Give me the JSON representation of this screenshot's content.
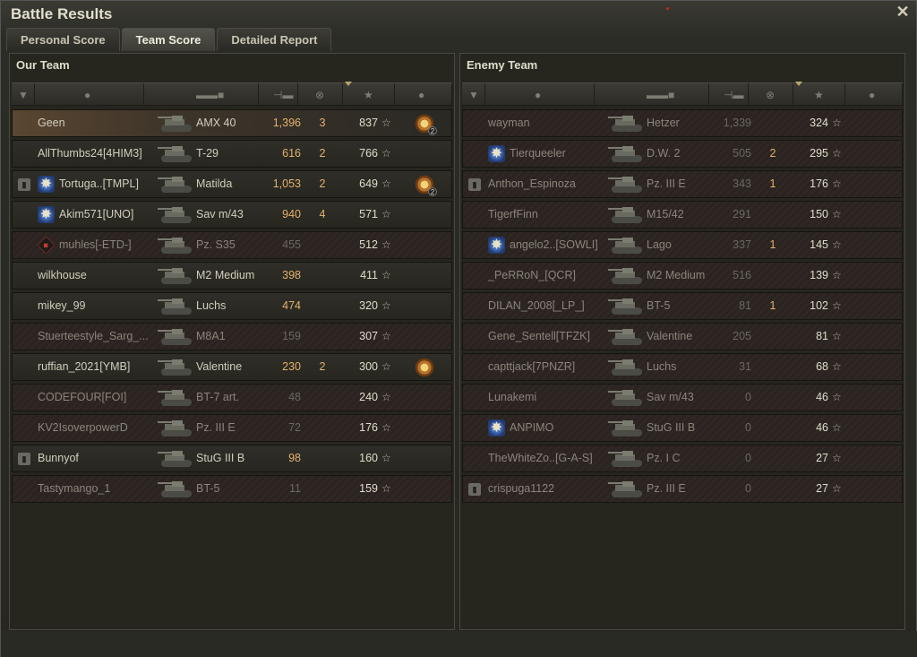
{
  "window": {
    "title": "Battle Results"
  },
  "tabs": [
    {
      "label": "Personal Score",
      "active": false
    },
    {
      "label": "Team Score",
      "active": true
    },
    {
      "label": "Detailed Report",
      "active": false
    }
  ],
  "our_team": {
    "title": "Our Team",
    "rows": [
      {
        "name": "Geen",
        "tank": "AMX 40",
        "damage": "1,396",
        "kills": "3",
        "xp": "837",
        "medal": "2",
        "player": true
      },
      {
        "name": "AllThumbs24[4HIM3]",
        "tank": "T-29",
        "damage": "616",
        "kills": "2",
        "xp": "766"
      },
      {
        "name": "Tortuga..[TMPL]",
        "tank": "Matilda",
        "damage": "1,053",
        "kills": "2",
        "xp": "649",
        "medal": "2",
        "platoon": true,
        "badge": "blue"
      },
      {
        "name": "Akim571[UNO]",
        "tank": "Sav m/43",
        "damage": "940",
        "kills": "4",
        "xp": "571",
        "badge": "blue"
      },
      {
        "name": "muhles[-ETD-]",
        "tank": "Pz. S35",
        "damage": "455",
        "kills": "",
        "xp": "512",
        "dead": true,
        "badge": "rank"
      },
      {
        "name": "wilkhouse",
        "tank": "M2 Medium",
        "damage": "398",
        "kills": "",
        "xp": "411"
      },
      {
        "name": "mikey_99",
        "tank": "Luchs",
        "damage": "474",
        "kills": "",
        "xp": "320"
      },
      {
        "name": "Stuerteestyle_Sarg_...",
        "tank": "M8A1",
        "damage": "159",
        "kills": "",
        "xp": "307",
        "dead": true
      },
      {
        "name": "ruffian_2021[YMB]",
        "tank": "Valentine",
        "damage": "230",
        "kills": "2",
        "xp": "300",
        "medal": ""
      },
      {
        "name": "CODEFOUR[FOI]",
        "tank": "BT-7 art.",
        "damage": "48",
        "kills": "",
        "xp": "240",
        "dead": true
      },
      {
        "name": "KV2IsoverpowerD",
        "tank": "Pz. III E",
        "damage": "72",
        "kills": "",
        "xp": "176",
        "dead": true
      },
      {
        "name": "Bunnyof",
        "tank": "StuG III B",
        "damage": "98",
        "kills": "",
        "xp": "160",
        "platoon": true
      },
      {
        "name": "Tastymango_1",
        "tank": "BT-5",
        "damage": "11",
        "kills": "",
        "xp": "159",
        "dead": true
      }
    ]
  },
  "enemy_team": {
    "title": "Enemy Team",
    "rows": [
      {
        "name": "wayman",
        "tank": "Hetzer",
        "damage": "1,339",
        "kills": "",
        "xp": "324",
        "dead": true
      },
      {
        "name": "Tierqueeler",
        "tank": "D.W. 2",
        "damage": "505",
        "kills": "2",
        "xp": "295",
        "dead": true,
        "badge": "blue"
      },
      {
        "name": "Anthon_Espinoza",
        "tank": "Pz. III E",
        "damage": "343",
        "kills": "1",
        "xp": "176",
        "dead": true,
        "platoon": true
      },
      {
        "name": "TigerfFinn",
        "tank": "M15/42",
        "damage": "291",
        "kills": "",
        "xp": "150",
        "dead": true
      },
      {
        "name": "angelo2..[SOWLI]",
        "tank": "Lago",
        "damage": "337",
        "kills": "1",
        "xp": "145",
        "dead": true,
        "badge": "blue"
      },
      {
        "name": "_PeRRoN_[QCR]",
        "tank": "M2 Medium",
        "damage": "516",
        "kills": "",
        "xp": "139",
        "dead": true
      },
      {
        "name": "DILAN_2008[_LP_]",
        "tank": "BT-5",
        "damage": "81",
        "kills": "1",
        "xp": "102",
        "dead": true
      },
      {
        "name": "Gene_Sentell[TFZK]",
        "tank": "Valentine",
        "damage": "205",
        "kills": "",
        "xp": "81",
        "dead": true
      },
      {
        "name": "capttjack[7PNZR]",
        "tank": "Luchs",
        "damage": "31",
        "kills": "",
        "xp": "68",
        "dead": true
      },
      {
        "name": "Lunakemi",
        "tank": "Sav m/43",
        "damage": "0",
        "kills": "",
        "xp": "46",
        "dead": true
      },
      {
        "name": "ANPIMO",
        "tank": "StuG III B",
        "damage": "0",
        "kills": "",
        "xp": "46",
        "dead": true,
        "badge": "blue"
      },
      {
        "name": "TheWhiteZo..[G-A-S]",
        "tank": "Pz. I C",
        "damage": "0",
        "kills": "",
        "xp": "27",
        "dead": true
      },
      {
        "name": "crispuga1122",
        "tank": "Pz. III E",
        "damage": "0",
        "kills": "",
        "xp": "27",
        "dead": true,
        "platoon": true
      }
    ]
  },
  "columns": [
    "squad-icon",
    "player-icon",
    "tank-icon",
    "damage-icon",
    "kills-icon",
    "xp-star-icon",
    "medal-icon"
  ],
  "colors": {
    "damage": "#e3b16d",
    "player_row": "#5a4630",
    "dead_row": "#2f2724"
  }
}
